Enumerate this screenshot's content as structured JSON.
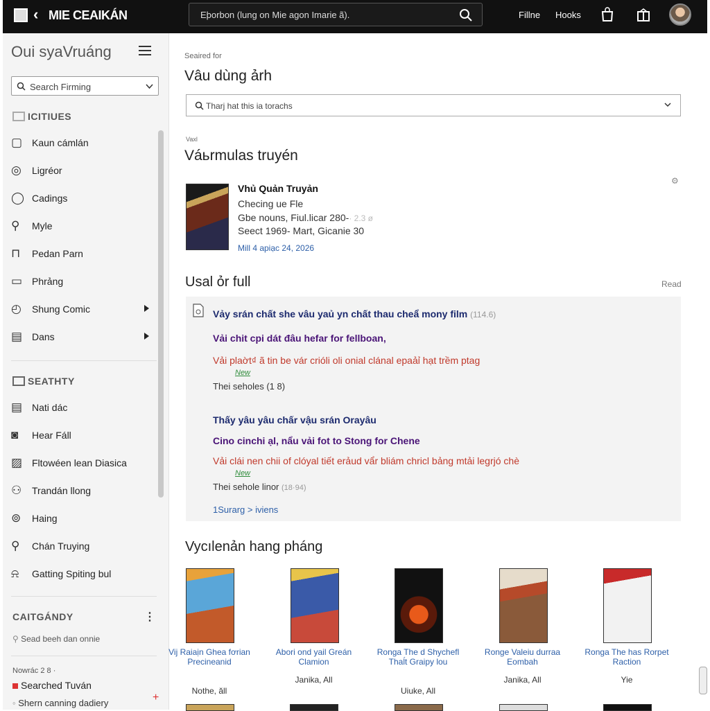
{
  "topbar": {
    "brand": "MIE CEAIKÁN",
    "search_placeholder": "Eþorbon (lung on Mie agon Imarie ã).",
    "links": [
      "Fillne",
      "Hooks"
    ]
  },
  "sidebar": {
    "title": "Oui syaVruáng",
    "search_placeholder": "Search Firming",
    "section1": "ICITIUES",
    "items1": [
      {
        "label": "Kaun cámlán",
        "icon": "square-icon"
      },
      {
        "label": "Ligréor",
        "icon": "compass-icon"
      },
      {
        "label": "Cadings",
        "icon": "drop-icon"
      },
      {
        "label": "Myle",
        "icon": "search-icon"
      },
      {
        "label": "Pedan Parn",
        "icon": "lock-icon"
      },
      {
        "label": "Phrảng",
        "icon": "folder-icon"
      },
      {
        "label": "Shung Comic",
        "icon": "clock-icon",
        "arrow": true
      },
      {
        "label": "Dans",
        "icon": "clipboard-icon",
        "arrow": true
      }
    ],
    "section2": "SEATHTY",
    "items2": [
      {
        "label": "Nati dác",
        "icon": "clipboard-icon"
      },
      {
        "label": "Hear Fáll",
        "icon": "camera-icon"
      },
      {
        "label": "Fltowéen lean Diasica",
        "icon": "image-icon"
      },
      {
        "label": "Trandán llong",
        "icon": "person-icon"
      },
      {
        "label": "Haing",
        "icon": "gamepad-icon"
      },
      {
        "label": "Chán Truying",
        "icon": "search-icon"
      },
      {
        "label": "Gatting Spiting bul",
        "icon": "bell-icon"
      }
    ],
    "section3": "CAITGÁNDY",
    "section3_note": "Sead beeh dan onnie",
    "footer_label": "Nowrác 2 8 ·",
    "footer_item1": "Searched Tuván",
    "footer_item2": "Shern canning dadiery"
  },
  "main": {
    "searched_label": "Seaired for",
    "query": "Vâu dùng  ảrh",
    "filter_placeholder": "Tharj hat this ia torachs",
    "small_label": "Vaxl",
    "results_heading": "Váьrmulas truyén",
    "featured": {
      "title": "Vhủ Quản Truyản",
      "line1": "Checing ue Fle",
      "line2": "Gbe nouns, Fiul.licar 280-",
      "line2_extra": "· 2.3 ø",
      "line3": "Seect  1969- Mart, Gicanie 30",
      "date": "Mill 4 apiạc 24, 2026"
    },
    "chapters_heading": "Usal ỏr full",
    "read_label": "Read",
    "panel": {
      "line1": "Vảy srán chất she vâu yaủ yn chất thau cheẩ mony film",
      "line1_count": "(114.6)",
      "line2": "Vải chit cpi dát đâu hefar for fellboan,",
      "line3": "Vải plaờt₫ ã tin be vár crióli oli onial clánal epaảỉ hạt trềm ptag",
      "new1": "New",
      "small1": "Thei seholes (1 8)",
      "line4": "Thấy yâu yâu chấr vậu srán Orayâu",
      "line5": "Cino cinchi ạl, nẩu vải fot to Stong for Chene",
      "line6": "Vải clái nen chii of clóyal tiết erảud vẩr bliám chricl bảng mtải legrjó chè",
      "new2": "New",
      "small2": "Thei sehole linor",
      "small2_count": "(18·94)",
      "link": "1Surarg > iviens"
    },
    "recommend_heading": "Vycılenản hang pháng",
    "cards": [
      {
        "title": "Vij Raiaịn Ghea fơrian Precineanid",
        "sub": "Nothe, ăll"
      },
      {
        "title": "Abori ond yail Greán Clamion",
        "sub": "Janika, All"
      },
      {
        "title": "Ronga The d Shychefl Thaĺt Graipy lou",
        "sub": "Uiuke, All"
      },
      {
        "title": "Ronge Valeiu durraa Eombah",
        "sub": "Janika, All"
      },
      {
        "title": "Ronga The has Rorpet Raction",
        "sub": "Yie"
      }
    ]
  },
  "colors": {
    "topbar": "#111111",
    "sidebar": "#f4f4f4",
    "panel": "#f3f3f3",
    "link": "#2d5fa8",
    "navy": "#1c2a6e",
    "purple": "#4a1477",
    "red": "#c0392b",
    "green": "#2e8b3a"
  }
}
